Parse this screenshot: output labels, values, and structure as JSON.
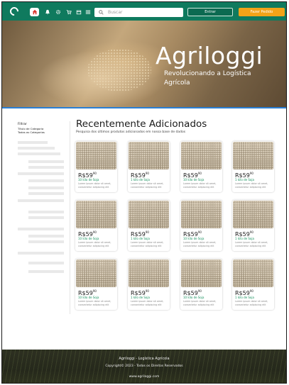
{
  "nav": {
    "search_placeholder": "Buscar",
    "enter_label": "Entrar",
    "sell_label": "Fazer Pedido"
  },
  "hero": {
    "title": "Agriloggi",
    "subtitle": "Revolucionando a Logística Agrícola"
  },
  "sidebar": {
    "links": [
      "Filtrar",
      "Título de Categoria",
      "Todas as Categorias"
    ]
  },
  "main": {
    "title": "Recentemente Adicionados",
    "description": "Pesquisa dos últimos produtos adicionados em nossa base de dados"
  },
  "products": [
    {
      "price": "R$59",
      "cents": "90",
      "name": "10 kilo de Soja",
      "desc": "Lorem ipsum dolor sit amet, consectetur adipiscing elit"
    },
    {
      "price": "R$59",
      "cents": "90",
      "name": "1 kilo de Soja",
      "desc": "Lorem ipsum dolor sit amet, consectetur adipiscing elit"
    },
    {
      "price": "R$59",
      "cents": "90",
      "name": "10 kilo de Soja",
      "desc": "Lorem ipsum dolor sit amet, consectetur adipiscing elit"
    },
    {
      "price": "R$59",
      "cents": "90",
      "name": "1 kilo de Soja",
      "desc": "Lorem ipsum dolor sit amet, consectetur adipiscing elit"
    },
    {
      "price": "R$59",
      "cents": "90",
      "name": "10 kilo de Soja",
      "desc": "Lorem ipsum dolor sit amet, consectetur adipiscing elit"
    },
    {
      "price": "R$59",
      "cents": "90",
      "name": "1 kilo de Soja",
      "desc": "Lorem ipsum dolor sit amet, consectetur adipiscing elit"
    },
    {
      "price": "R$59",
      "cents": "90",
      "name": "10 kilo de Soja",
      "desc": "Lorem ipsum dolor sit amet, consectetur adipiscing elit"
    },
    {
      "price": "R$59",
      "cents": "90",
      "name": "1 kilo de Soja",
      "desc": "Lorem ipsum dolor sit amet, consectetur adipiscing elit"
    },
    {
      "price": "R$59",
      "cents": "90",
      "name": "10 kilo de Soja",
      "desc": "Lorem ipsum dolor sit amet, consectetur adipiscing elit"
    },
    {
      "price": "R$59",
      "cents": "90",
      "name": "1 kilo de Soja",
      "desc": "Lorem ipsum dolor sit amet, consectetur adipiscing elit"
    },
    {
      "price": "R$59",
      "cents": "90",
      "name": "10 kilo de Soja",
      "desc": "Lorem ipsum dolor sit amet, consectetur adipiscing elit"
    },
    {
      "price": "R$59",
      "cents": "90",
      "name": "1 kilo de Soja",
      "desc": "Lorem ipsum dolor sit amet, consectetur adipiscing elit"
    }
  ],
  "footer": {
    "brand": "Agriloggi - Logística Agrícola",
    "copyright": "Copyright© 2023 - Todos os Direitos Reservados",
    "site": "www.agriloggi.com"
  },
  "colors": {
    "nav": "#0f7a5e",
    "accent_orange": "#f2a318",
    "product_name": "#15905c"
  }
}
